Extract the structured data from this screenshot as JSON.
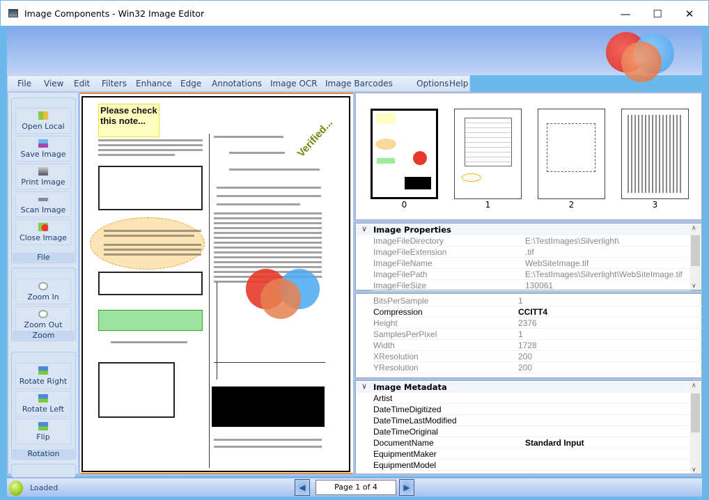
{
  "window": {
    "title": "Image Components - Win32 Image Editor",
    "controls": [
      "minimize",
      "maximize",
      "close"
    ]
  },
  "menu": [
    "File",
    "View",
    "Edit",
    "Filters",
    "Enhance",
    "Edge",
    "Annotations",
    "Image OCR",
    "Image Barcodes",
    "Options",
    "Help"
  ],
  "sidebar": {
    "groups": [
      {
        "label": "File",
        "buttons": [
          {
            "label": "Open Local",
            "icon": "open-folder-icon"
          },
          {
            "label": "Save Image",
            "icon": "save-icon"
          },
          {
            "label": "Print Image",
            "icon": "printer-icon"
          },
          {
            "label": "Scan Image",
            "icon": "scanner-icon"
          },
          {
            "label": "Close Image",
            "icon": "close-image-icon"
          }
        ]
      },
      {
        "label": "Zoom",
        "buttons": [
          {
            "label": "Zoom In",
            "icon": "zoom-in-icon"
          },
          {
            "label": "Zoom Out",
            "icon": "zoom-out-icon"
          }
        ]
      },
      {
        "label": "Rotation",
        "buttons": [
          {
            "label": "Rotate Right",
            "icon": "rotate-right-icon"
          },
          {
            "label": "Rotate Left",
            "icon": "rotate-left-icon"
          },
          {
            "label": "Flip",
            "icon": "flip-icon"
          }
        ]
      }
    ]
  },
  "document": {
    "note": "Please check this note...",
    "stamp": "Verified..."
  },
  "thumbnails": [
    "0",
    "1",
    "2",
    "3"
  ],
  "properties": {
    "title": "Image Properties",
    "file_rows": [
      {
        "key": "ImageFileDirectory",
        "value": "E:\\TestImages\\Silverlight\\"
      },
      {
        "key": "ImageFileExtension",
        "value": ".tif"
      },
      {
        "key": "ImageFileName",
        "value": "WebSiteImage.tif"
      },
      {
        "key": "ImageFilePath",
        "value": "E:\\TestImages\\Silverlight\\WebSiteImage.tif"
      },
      {
        "key": "ImageFileSize",
        "value": "130061"
      }
    ],
    "image_rows": [
      {
        "key": "BitsPerSample",
        "value": "1"
      },
      {
        "key": "Compression",
        "value": "CCITT4"
      },
      {
        "key": "Height",
        "value": "2376"
      },
      {
        "key": "SamplesPerPixel",
        "value": "1"
      },
      {
        "key": "Width",
        "value": "1728"
      },
      {
        "key": "XResolution",
        "value": "200"
      },
      {
        "key": "YResolution",
        "value": "200"
      }
    ]
  },
  "metadata": {
    "title": "Image Metadata",
    "rows": [
      {
        "key": "Artist",
        "value": ""
      },
      {
        "key": "DateTimeDigitized",
        "value": ""
      },
      {
        "key": "DateTimeLastModified",
        "value": ""
      },
      {
        "key": "DateTimeOriginal",
        "value": ""
      },
      {
        "key": "DocumentName",
        "value": "Standard Input"
      },
      {
        "key": "EquipmentMaker",
        "value": ""
      },
      {
        "key": "EquipmentModel",
        "value": ""
      }
    ]
  },
  "status": {
    "text": "Loaded",
    "page": "Page 1 of 4"
  },
  "colors": {
    "accent": "#f08a3a",
    "frame": "#6cb8ec",
    "banner": "#7fa9e8"
  }
}
